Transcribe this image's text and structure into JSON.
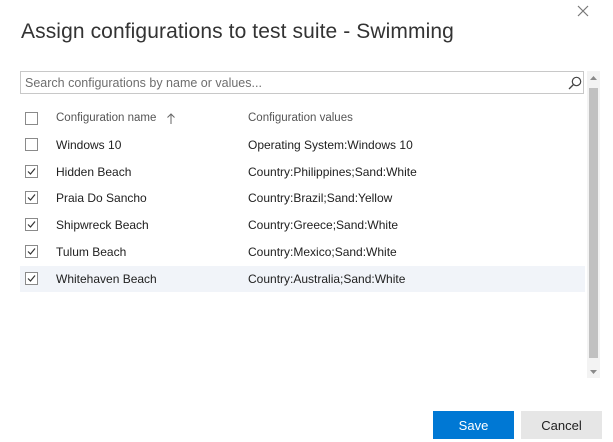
{
  "dialog": {
    "title": "Assign configurations to test suite - Swimming",
    "close_icon": "close-icon"
  },
  "search": {
    "placeholder": "Search configurations by name or values...",
    "value": "",
    "icon": "search-icon"
  },
  "table": {
    "headers": {
      "name": "Configuration name",
      "values": "Configuration values",
      "sort_icon": "arrow-up-icon"
    },
    "rows": [
      {
        "name": "Windows 10",
        "values": "Operating System:Windows 10",
        "checked": false
      },
      {
        "name": "Hidden Beach",
        "values": "Country:Philippines;Sand:White",
        "checked": true
      },
      {
        "name": "Praia Do Sancho",
        "values": "Country:Brazil;Sand:Yellow",
        "checked": true
      },
      {
        "name": "Shipwreck Beach",
        "values": "Country:Greece;Sand:White",
        "checked": true
      },
      {
        "name": "Tulum Beach",
        "values": "Country:Mexico;Sand:White",
        "checked": true
      },
      {
        "name": "Whitehaven Beach",
        "values": "Country:Australia;Sand:White",
        "checked": true
      }
    ],
    "highlighted_row": 5
  },
  "footer": {
    "save_label": "Save",
    "cancel_label": "Cancel"
  },
  "colors": {
    "primary": "#0078d4",
    "row_highlight": "#f1f4f9"
  }
}
